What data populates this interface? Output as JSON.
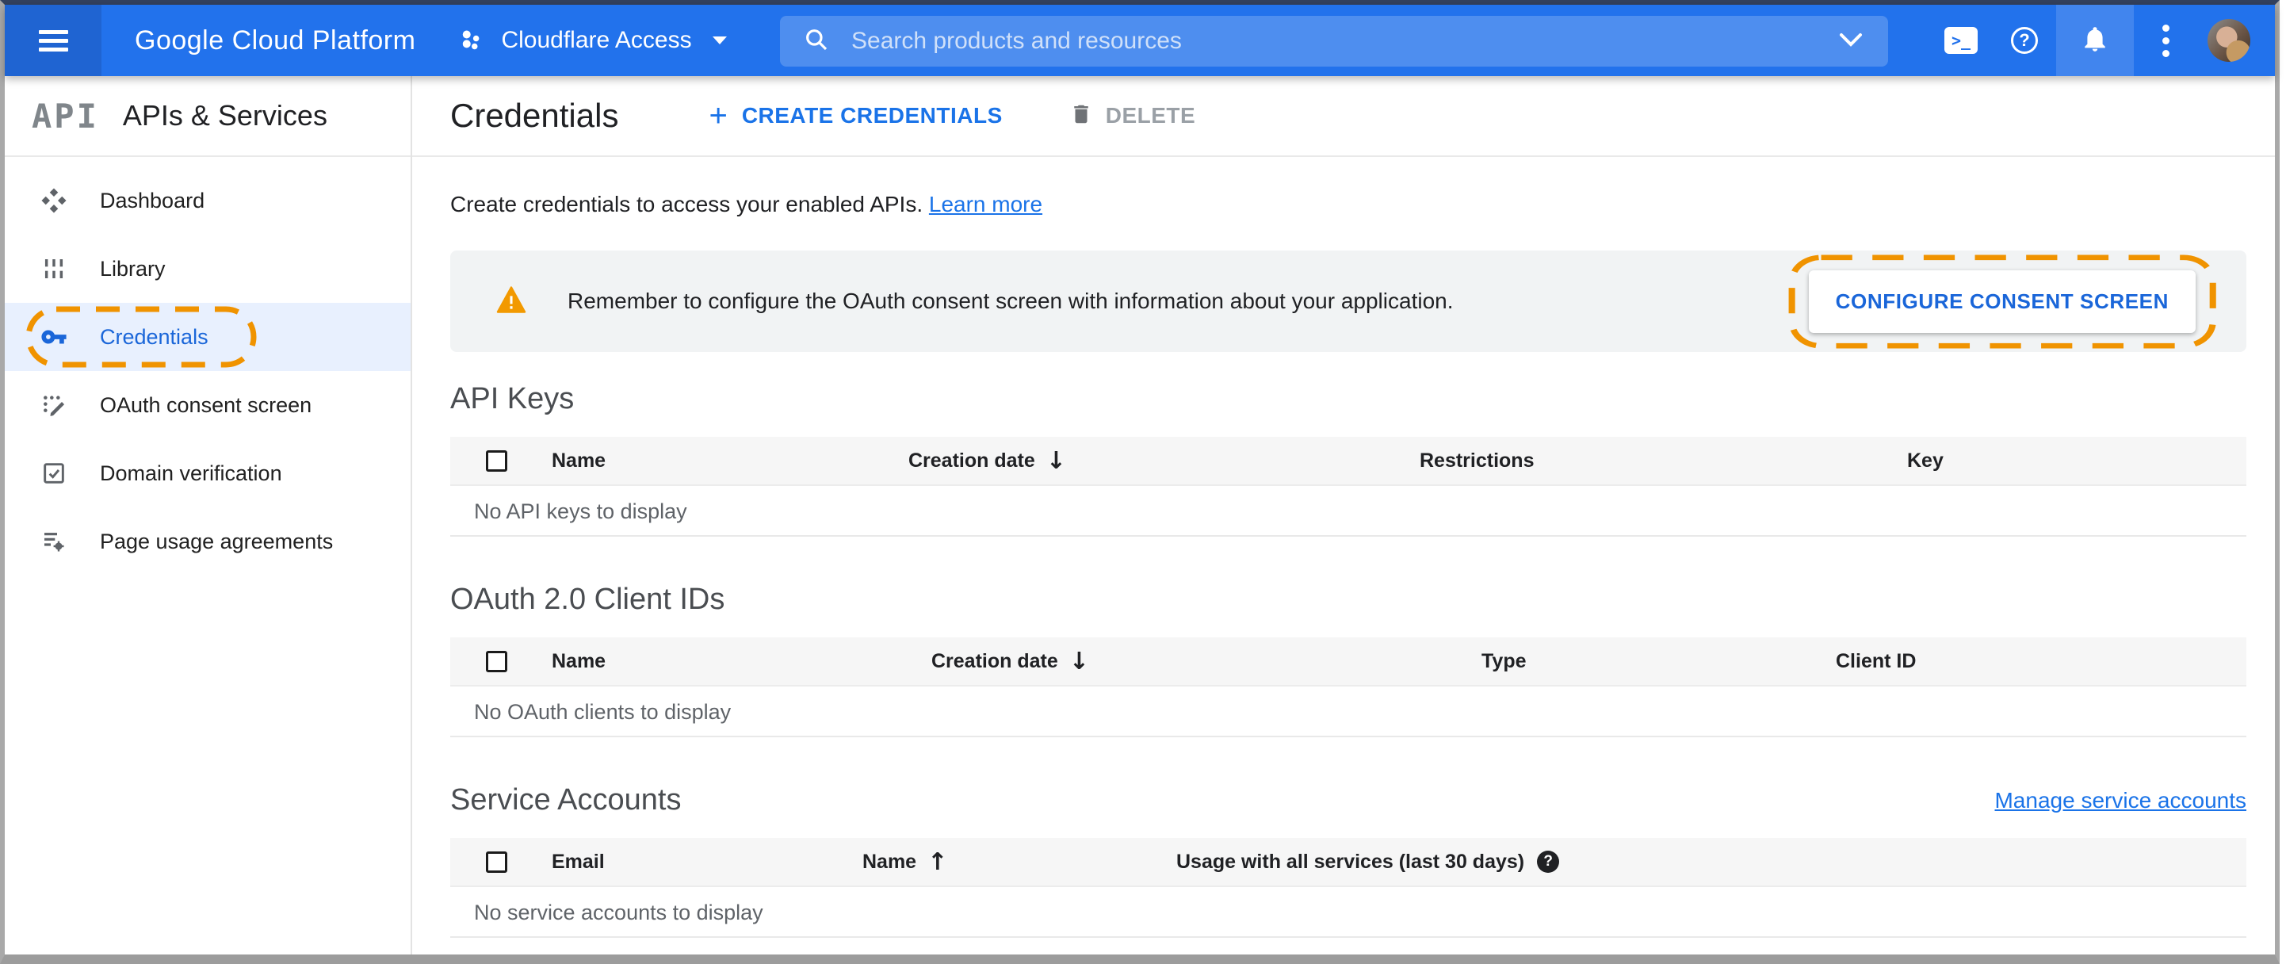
{
  "topbar": {
    "logo": "Google Cloud Platform",
    "project_selector": "Cloudflare Access",
    "search_placeholder": "Search products and resources"
  },
  "sidebar": {
    "logo_text": "API",
    "title": "APIs & Services",
    "items": [
      {
        "label": "Dashboard",
        "icon": "dashboard-icon",
        "active": false
      },
      {
        "label": "Library",
        "icon": "library-icon",
        "active": false
      },
      {
        "label": "Credentials",
        "icon": "key-icon",
        "active": true,
        "annotated": true
      },
      {
        "label": "OAuth consent screen",
        "icon": "consent-icon",
        "active": false
      },
      {
        "label": "Domain verification",
        "icon": "domain-verification-icon",
        "active": false
      },
      {
        "label": "Page usage agreements",
        "icon": "agreements-icon",
        "active": false
      }
    ]
  },
  "header": {
    "title": "Credentials",
    "create_label": "CREATE CREDENTIALS",
    "delete_label": "DELETE"
  },
  "intro": {
    "text": "Create credentials to access your enabled APIs. ",
    "link": "Learn more"
  },
  "banner": {
    "message": "Remember to configure the OAuth consent screen with information about your application.",
    "action_label": "CONFIGURE CONSENT SCREEN"
  },
  "sections": {
    "api_keys": {
      "title": "API Keys",
      "columns": [
        "Name",
        "Creation date",
        "Restrictions",
        "Key"
      ],
      "sort": {
        "column": "Creation date",
        "direction": "desc"
      },
      "empty": "No API keys to display"
    },
    "oauth": {
      "title": "OAuth 2.0 Client IDs",
      "columns": [
        "Name",
        "Creation date",
        "Type",
        "Client ID"
      ],
      "sort": {
        "column": "Creation date",
        "direction": "desc"
      },
      "empty": "No OAuth clients to display"
    },
    "service_accounts": {
      "title": "Service Accounts",
      "manage_link": "Manage service accounts",
      "columns": [
        "Email",
        "Name",
        "Usage with all services (last 30 days)"
      ],
      "sort": {
        "column": "Name",
        "direction": "asc"
      },
      "empty": "No service accounts to display"
    }
  },
  "icons": {
    "sort_desc": "↓",
    "sort_up": "↑",
    "question": "?",
    "shell_glyph": ">_"
  },
  "colors": {
    "accent_blue": "#1a73e8",
    "topbar_blue": "#2272ec",
    "annotation_orange": "#f09300",
    "warning_orange": "#f29900",
    "active_item_bg": "#e8f0fe",
    "banner_bg": "#f1f3f4"
  }
}
